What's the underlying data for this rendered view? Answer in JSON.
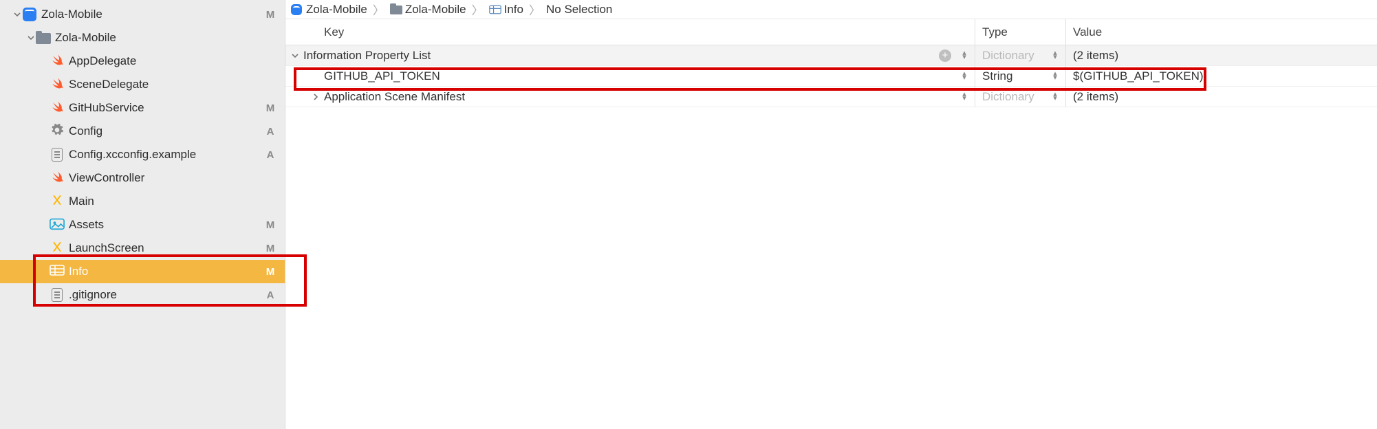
{
  "sidebar": {
    "project": {
      "label": "Zola-Mobile",
      "status": "M"
    },
    "group": {
      "label": "Zola-Mobile"
    },
    "files": [
      {
        "label": "AppDelegate",
        "icon": "swift",
        "status": ""
      },
      {
        "label": "SceneDelegate",
        "icon": "swift",
        "status": ""
      },
      {
        "label": "GitHubService",
        "icon": "swift",
        "status": "M"
      },
      {
        "label": "Config",
        "icon": "gear",
        "status": "A"
      },
      {
        "label": "Config.xcconfig.example",
        "icon": "doc",
        "status": "A"
      },
      {
        "label": "ViewController",
        "icon": "swift",
        "status": ""
      },
      {
        "label": "Main",
        "icon": "storyboard",
        "status": ""
      },
      {
        "label": "Assets",
        "icon": "assets",
        "status": "M"
      },
      {
        "label": "LaunchScreen",
        "icon": "storyboard",
        "status": "M"
      },
      {
        "label": "Info",
        "icon": "plist",
        "status": "M",
        "selected": true
      },
      {
        "label": ".gitignore",
        "icon": "doc",
        "status": "A"
      }
    ]
  },
  "breadcrumb": {
    "items": [
      {
        "label": "Zola-Mobile",
        "icon": "app"
      },
      {
        "label": "Zola-Mobile",
        "icon": "folder"
      },
      {
        "label": "Info",
        "icon": "plist"
      },
      {
        "label": "No Selection",
        "icon": ""
      }
    ]
  },
  "plist": {
    "headers": {
      "key": "Key",
      "type": "Type",
      "value": "Value"
    },
    "rows": [
      {
        "key": "Information Property List",
        "type": "Dictionary",
        "value": "(2 items)",
        "section": true,
        "expanded": true,
        "typeMuted": true
      },
      {
        "key": "GITHUB_API_TOKEN",
        "type": "String",
        "value": "$(GITHUB_API_TOKEN)",
        "indent": 1,
        "highlighted": true
      },
      {
        "key": "Application Scene Manifest",
        "type": "Dictionary",
        "value": "(2 items)",
        "indent": 1,
        "expandable": true,
        "typeMuted": true
      }
    ]
  }
}
